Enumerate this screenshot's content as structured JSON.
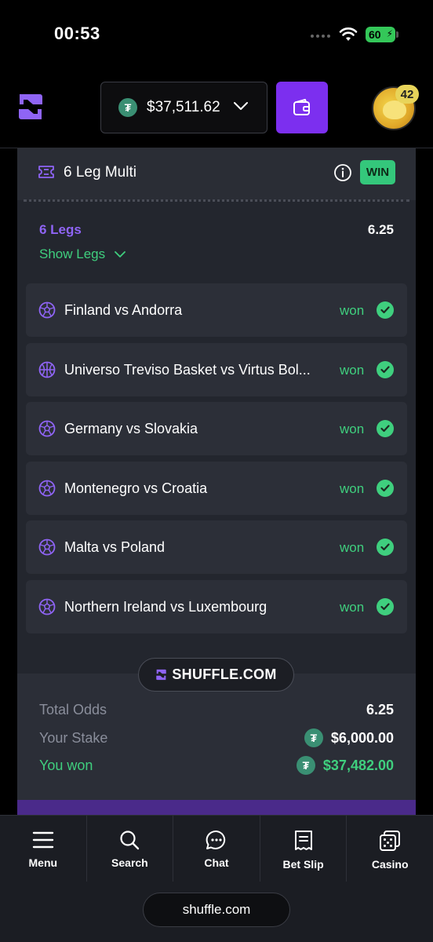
{
  "status_bar": {
    "time": "00:53",
    "battery": "60"
  },
  "header": {
    "balance": "$37,511.62",
    "currency_icon": "tether-icon",
    "avatar_badge": "42"
  },
  "ticket": {
    "title": "6 Leg Multi",
    "result_badge": "WIN",
    "legs_count_label": "6 Legs",
    "odds": "6.25",
    "show_legs_label": "Show Legs",
    "legs": [
      {
        "name": "Finland vs Andorra",
        "sport_icon": "soccer-ball-icon",
        "status": "won"
      },
      {
        "name": "Universo Treviso Basket vs Virtus Bol...",
        "sport_icon": "basketball-icon",
        "status": "won"
      },
      {
        "name": "Germany vs Slovakia",
        "sport_icon": "soccer-ball-icon",
        "status": "won"
      },
      {
        "name": "Montenegro vs Croatia",
        "sport_icon": "soccer-ball-icon",
        "status": "won"
      },
      {
        "name": "Malta vs Poland",
        "sport_icon": "soccer-ball-icon",
        "status": "won"
      },
      {
        "name": "Northern Ireland vs Luxembourg",
        "sport_icon": "soccer-ball-icon",
        "status": "won"
      }
    ],
    "brand": "SHUFFLE.COM",
    "summary": {
      "total_odds_label": "Total Odds",
      "total_odds_value": "6.25",
      "stake_label": "Your Stake",
      "stake_value": "$6,000.00",
      "won_label": "You won",
      "won_value": "$37,482.00"
    }
  },
  "nav": {
    "items": [
      {
        "label": "Menu",
        "icon": "menu-icon"
      },
      {
        "label": "Search",
        "icon": "search-icon"
      },
      {
        "label": "Chat",
        "icon": "chat-icon"
      },
      {
        "label": "Bet Slip",
        "icon": "bet-slip-icon"
      },
      {
        "label": "Casino",
        "icon": "dice-icon"
      }
    ]
  },
  "browser": {
    "url": "shuffle.com"
  },
  "colors": {
    "accent_purple": "#7c2fef",
    "win_green": "#3fcf7e",
    "card_bg": "#23262e",
    "tether_green": "#3a8f73"
  }
}
